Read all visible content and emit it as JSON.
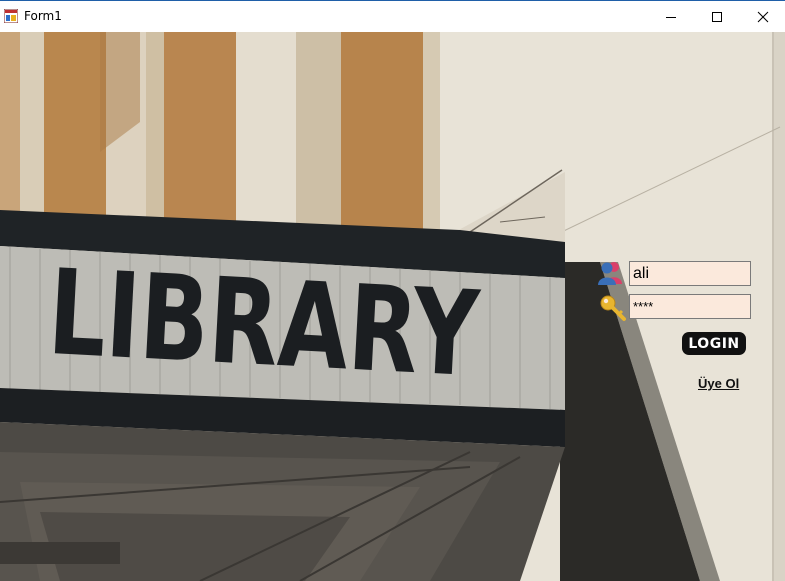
{
  "window": {
    "title": "Form1",
    "controls": [
      "minimize-icon",
      "maximize-icon",
      "close-icon"
    ]
  },
  "background": {
    "sign_text": "LIBRARY"
  },
  "login": {
    "username_value": "ali",
    "password_value": "****",
    "login_button_label": "LOGIN",
    "register_link_label": "Üye Ol",
    "field_color": "#fbe9dc",
    "user_icon": "user-group-icon",
    "password_icon": "key-icon"
  }
}
